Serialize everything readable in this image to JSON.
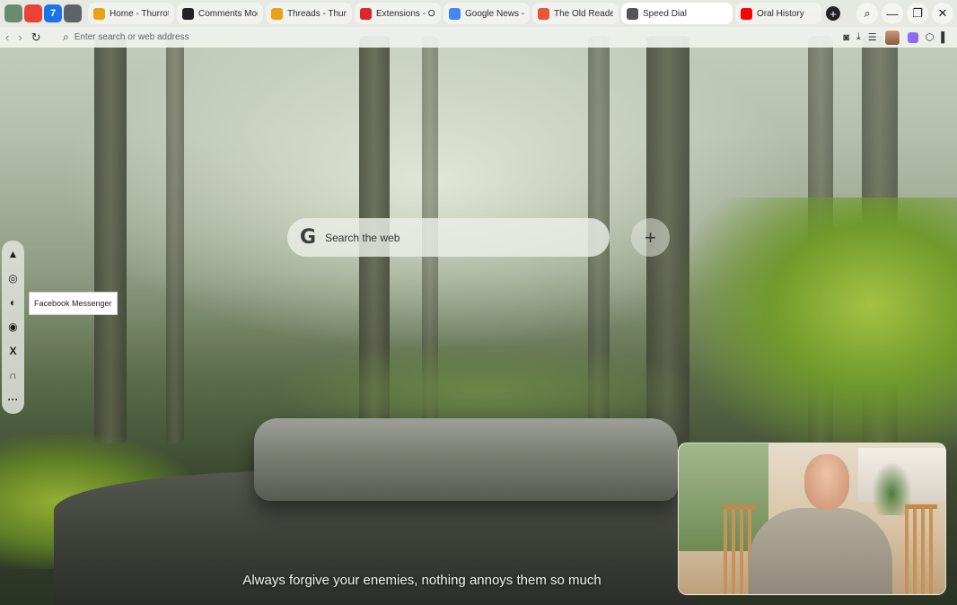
{
  "browser": {
    "pinned_tabs": [
      {
        "icon": "opera-gx-icon",
        "color": "#6b8a74"
      },
      {
        "icon": "gmail-icon",
        "color": "#ea4335"
      },
      {
        "icon": "calendar-icon",
        "color": "#1a73e8",
        "text": "7"
      },
      {
        "icon": "contacts-icon",
        "color": "#5f6368"
      }
    ],
    "tabs": [
      {
        "title": "Home - Thurrott",
        "icon": "thurrott-icon",
        "color": "#e8a21a",
        "active": false
      },
      {
        "title": "Comments Mode",
        "icon": "comments-icon",
        "color": "#222222",
        "active": false
      },
      {
        "title": "Threads - Thurrott",
        "icon": "threads-icon",
        "color": "#e8a21a",
        "active": false
      },
      {
        "title": "Extensions - Opera",
        "icon": "opera-icon",
        "color": "#e0252a",
        "active": false
      },
      {
        "title": "Google News - T",
        "icon": "google-news-icon",
        "color": "#4285f4",
        "active": false
      },
      {
        "title": "The Old Reader",
        "icon": "old-reader-icon",
        "color": "#e8553a",
        "active": false
      },
      {
        "title": "Speed Dial",
        "icon": "speed-dial-icon",
        "color": "#555555",
        "active": true
      },
      {
        "title": "Oral History",
        "icon": "youtube-icon",
        "color": "#ff0000",
        "active": false
      }
    ],
    "new_tab_symbol": "+",
    "window_controls": {
      "search": "⌕",
      "minimize": "—",
      "restore": "❐",
      "close": "✕"
    },
    "address_placeholder": "Enter search or web address"
  },
  "sidebar": {
    "items": [
      {
        "name": "aria-icon",
        "glyph": "▲"
      },
      {
        "name": "instagram-icon",
        "glyph": "◎"
      },
      {
        "name": "messenger-icon",
        "glyph": "◐"
      },
      {
        "name": "whatsapp-icon",
        "glyph": "◉"
      },
      {
        "name": "x-icon",
        "glyph": "X"
      },
      {
        "name": "music-player-icon",
        "glyph": "∩"
      },
      {
        "name": "more-icon",
        "glyph": "···"
      }
    ],
    "tooltip": "Facebook Messenger"
  },
  "speed_dial": {
    "search_placeholder": "Search the web",
    "search_logo": "G",
    "add_symbol": "+"
  },
  "wallpaper_quote": "Always forgive your enemies, nothing annoys them so much"
}
